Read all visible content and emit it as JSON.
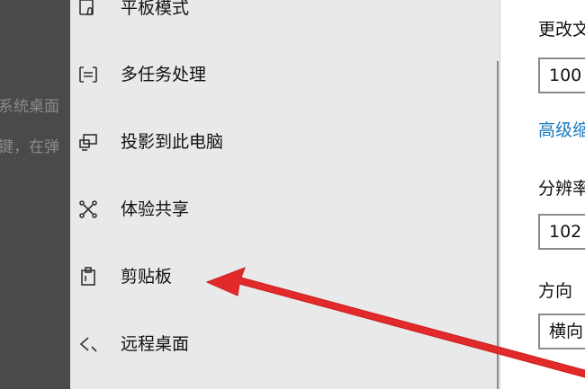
{
  "background_doc": {
    "line1": "系统桌面",
    "line2": "键，在弹"
  },
  "sidebar": {
    "items": [
      {
        "label": "平板模式",
        "icon": "tablet-mode-icon"
      },
      {
        "label": "多任务处理",
        "icon": "multitasking-icon"
      },
      {
        "label": "投影到此电脑",
        "icon": "project-to-pc-icon"
      },
      {
        "label": "体验共享",
        "icon": "shared-experiences-icon"
      },
      {
        "label": "剪贴板",
        "icon": "clipboard-icon"
      },
      {
        "label": "远程桌面",
        "icon": "remote-desktop-icon"
      }
    ]
  },
  "right_panel": {
    "scale_label": "更改文",
    "scale_value": "100",
    "advanced_link": "高级缩",
    "resolution_label": "分辨率",
    "resolution_value": "102",
    "orientation_label": "方向",
    "orientation_value": "横向"
  },
  "colors": {
    "sidebar_bg": "#eae9ea",
    "link": "#1a7abf",
    "arrow": "#e32a2a"
  }
}
